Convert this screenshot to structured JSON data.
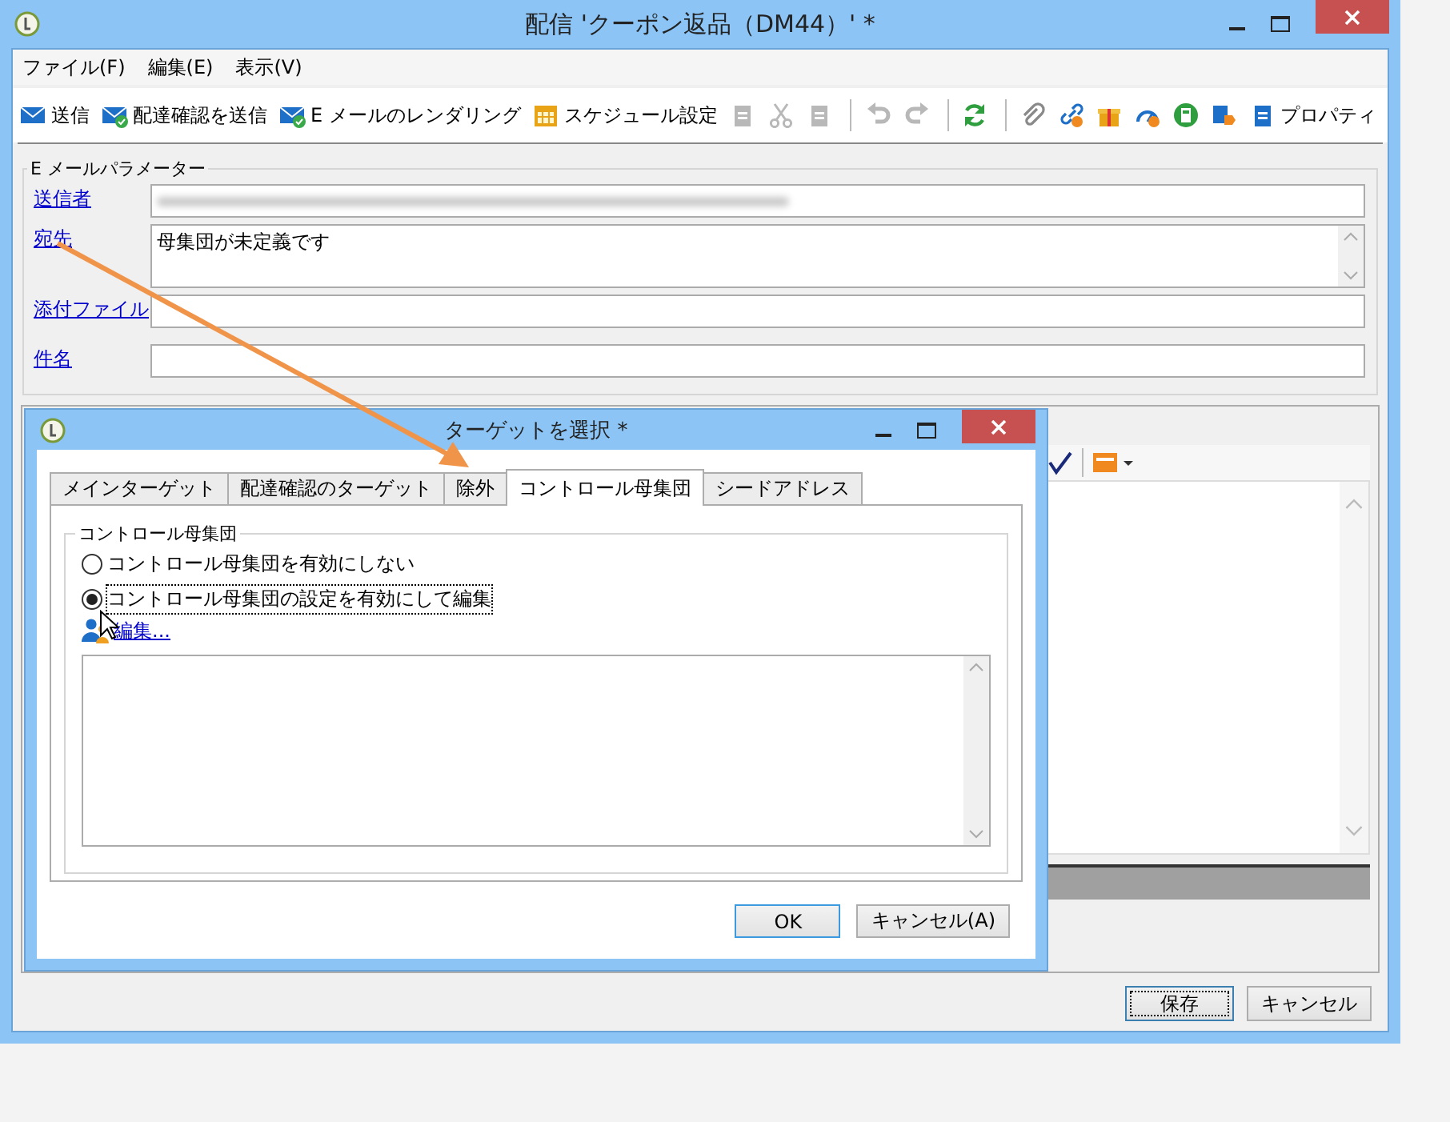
{
  "window": {
    "title": "配信 'クーポン返品（DM44）' *"
  },
  "menu": [
    "ファイル(F)",
    "編集(E)",
    "表示(V)"
  ],
  "toolbar": [
    {
      "kind": "send",
      "label": "送信",
      "disabled": false
    },
    {
      "kind": "proof",
      "label": "配達確認を送信",
      "disabled": false
    },
    {
      "kind": "render",
      "label": "E メールのレンダリング",
      "disabled": false
    },
    {
      "kind": "schedule",
      "label": "スケジュール設定",
      "disabled": false
    },
    {
      "kind": "copy",
      "disabled": true
    },
    {
      "kind": "cut",
      "disabled": true
    },
    {
      "kind": "paste",
      "disabled": true
    },
    {
      "kind": "separator"
    },
    {
      "kind": "undo",
      "disabled": true
    },
    {
      "kind": "redo",
      "disabled": true
    },
    {
      "kind": "separator"
    },
    {
      "kind": "refresh",
      "disabled": false
    },
    {
      "kind": "separator"
    },
    {
      "kind": "attach",
      "disabled": false
    },
    {
      "kind": "link",
      "disabled": false
    },
    {
      "kind": "gift",
      "disabled": false
    },
    {
      "kind": "gauge",
      "disabled": false
    },
    {
      "kind": "calculator",
      "disabled": false
    },
    {
      "kind": "tag",
      "disabled": false
    },
    {
      "kind": "properties",
      "label": "プロパティ",
      "disabled": false
    }
  ],
  "email_params": {
    "legend": "E メールパラメーター",
    "fields": [
      {
        "label": "送信者",
        "kind": "blurred"
      },
      {
        "label": "宛先",
        "kind": "multiline",
        "value": "母集団が未定義です"
      },
      {
        "label": "添付ファイル",
        "kind": "text"
      },
      {
        "label": "件名",
        "kind": "text"
      }
    ]
  },
  "footer_buttons": [
    {
      "label": "保存",
      "focused": true
    },
    {
      "label": "キャンセル",
      "focused": false
    }
  ],
  "dialog": {
    "title": "ターゲットを選択 *",
    "tabs": [
      {
        "label": "メインターゲット",
        "selected": false
      },
      {
        "label": "配達確認のターゲット",
        "selected": false
      },
      {
        "label": "除外",
        "selected": false
      },
      {
        "label": "コントロール母集団",
        "selected": true
      },
      {
        "label": "シードアドレス",
        "selected": false
      }
    ],
    "group": {
      "legend": "コントロール母集団",
      "options": [
        {
          "label": "コントロール母集団を有効にしない",
          "selected": false
        },
        {
          "label": "コントロール母集団の設定を有効にして編集",
          "selected": true
        }
      ],
      "edit_link": "編集..."
    },
    "buttons": [
      {
        "label": "OK",
        "focused": true
      },
      {
        "label": "キャンセル(A)",
        "focused": false
      }
    ]
  }
}
